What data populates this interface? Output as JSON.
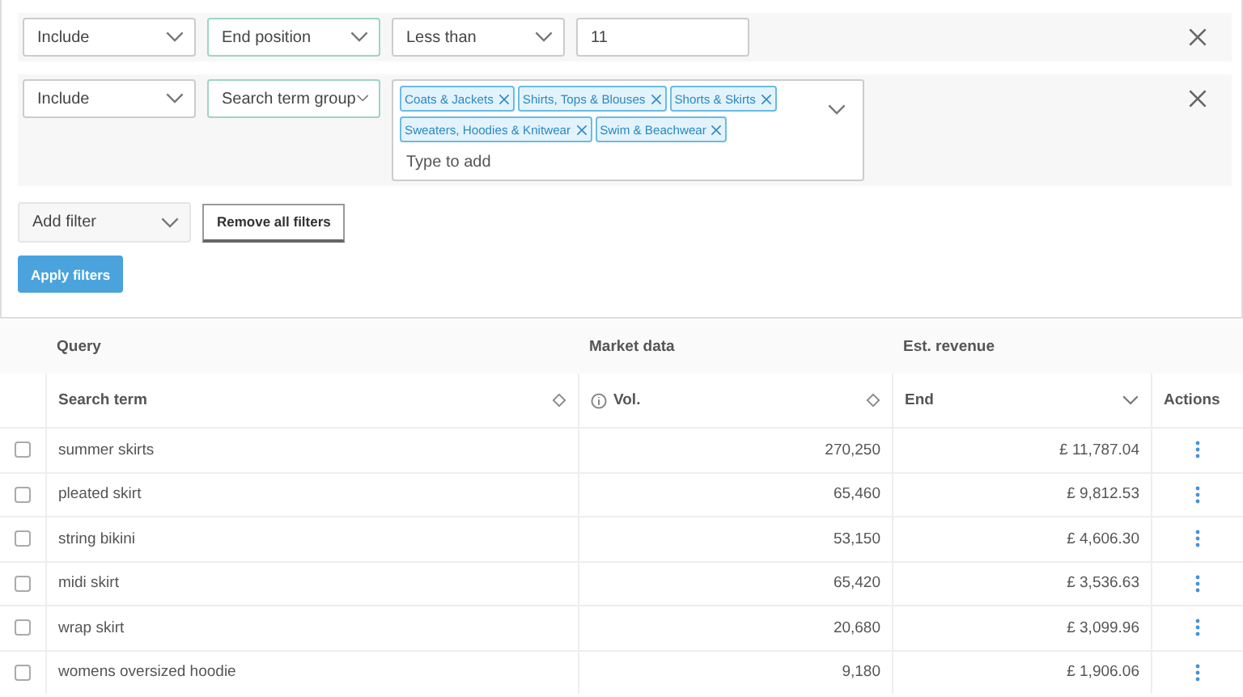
{
  "filters": [
    {
      "mode": "Include",
      "field": "End position",
      "operator": "Less than",
      "value": "11"
    },
    {
      "mode": "Include",
      "field": "Search term group",
      "tags": [
        "Coats & Jackets",
        "Shirts, Tops & Blouses",
        "Shorts & Skirts",
        "Sweaters, Hoodies & Knitwear",
        "Swim & Beachwear"
      ],
      "placeholder": "Type to add"
    }
  ],
  "add_filter": "Add filter",
  "remove_all": "Remove all filters",
  "apply": "Apply filters",
  "table": {
    "groups": [
      "Query",
      "Market data",
      "Est. revenue"
    ],
    "columns": [
      "Search term",
      "Vol.",
      "End",
      "Actions"
    ],
    "rows": [
      {
        "checked": false,
        "term": "summer skirts",
        "vol": "270,250",
        "end": "£ 11,787.04"
      },
      {
        "checked": false,
        "term": "pleated skirt",
        "vol": "65,460",
        "end": "£ 9,812.53"
      },
      {
        "checked": false,
        "term": "string bikini",
        "vol": "53,150",
        "end": "£ 4,606.30"
      },
      {
        "checked": false,
        "term": "midi skirt",
        "vol": "65,420",
        "end": "£ 3,536.63"
      },
      {
        "checked": false,
        "term": "wrap skirt",
        "vol": "20,680",
        "end": "£ 3,099.96"
      },
      {
        "checked": false,
        "term": "womens oversized hoodie",
        "vol": "9,180",
        "end": "£ 1,906.06"
      }
    ]
  }
}
